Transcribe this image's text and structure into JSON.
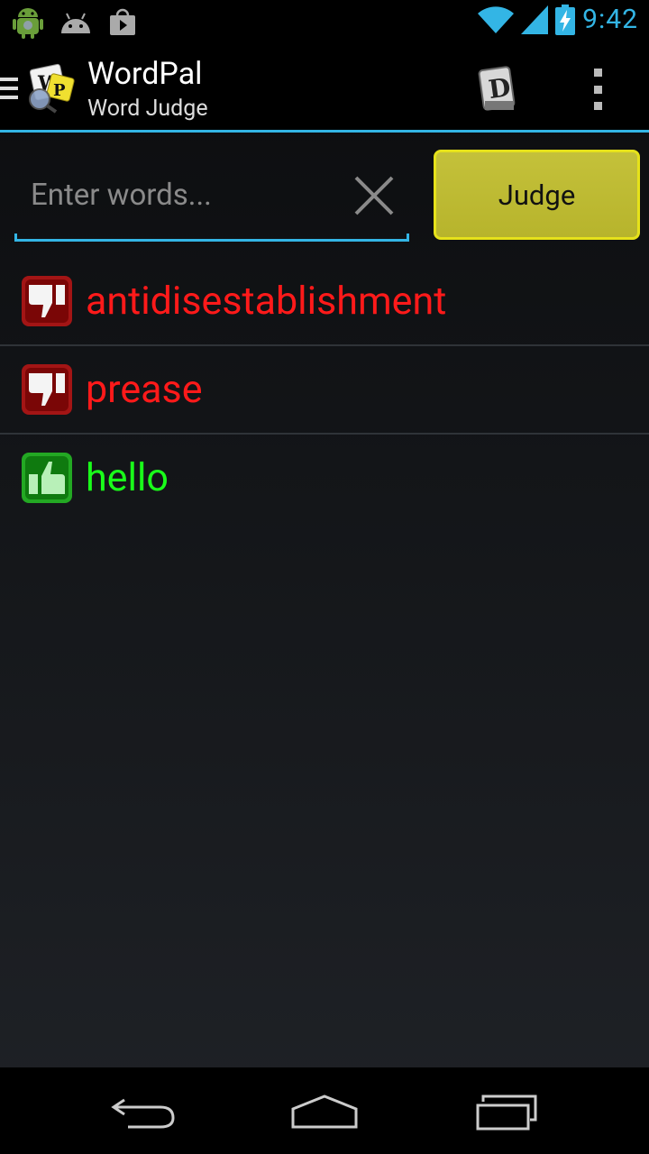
{
  "status_bar": {
    "clock": "9:42",
    "icons": [
      "android-debug-icon",
      "android-icon",
      "play-store-icon",
      "wifi-icon",
      "signal-icon",
      "battery-charging-icon"
    ]
  },
  "action_bar": {
    "title": "WordPal",
    "subtitle": "Word Judge",
    "icons": [
      "menu-icon",
      "wordpal-logo-icon",
      "dictionary-icon",
      "overflow-menu-icon"
    ]
  },
  "input": {
    "placeholder": "Enter words...",
    "value": ""
  },
  "judge_button": {
    "label": "Judge"
  },
  "results": [
    {
      "word": "antidisestablishment",
      "valid": false,
      "icon": "thumbs-down-icon"
    },
    {
      "word": "prease",
      "valid": false,
      "icon": "thumbs-down-icon"
    },
    {
      "word": "hello",
      "valid": true,
      "icon": "thumbs-up-icon"
    }
  ],
  "colors": {
    "accent": "#33b5e5",
    "judge_button": "#bfbc33",
    "invalid": "#ff1a1a",
    "valid": "#1aff1a"
  },
  "nav_bar": {
    "icons": [
      "back-icon",
      "home-icon",
      "recent-apps-icon"
    ]
  }
}
